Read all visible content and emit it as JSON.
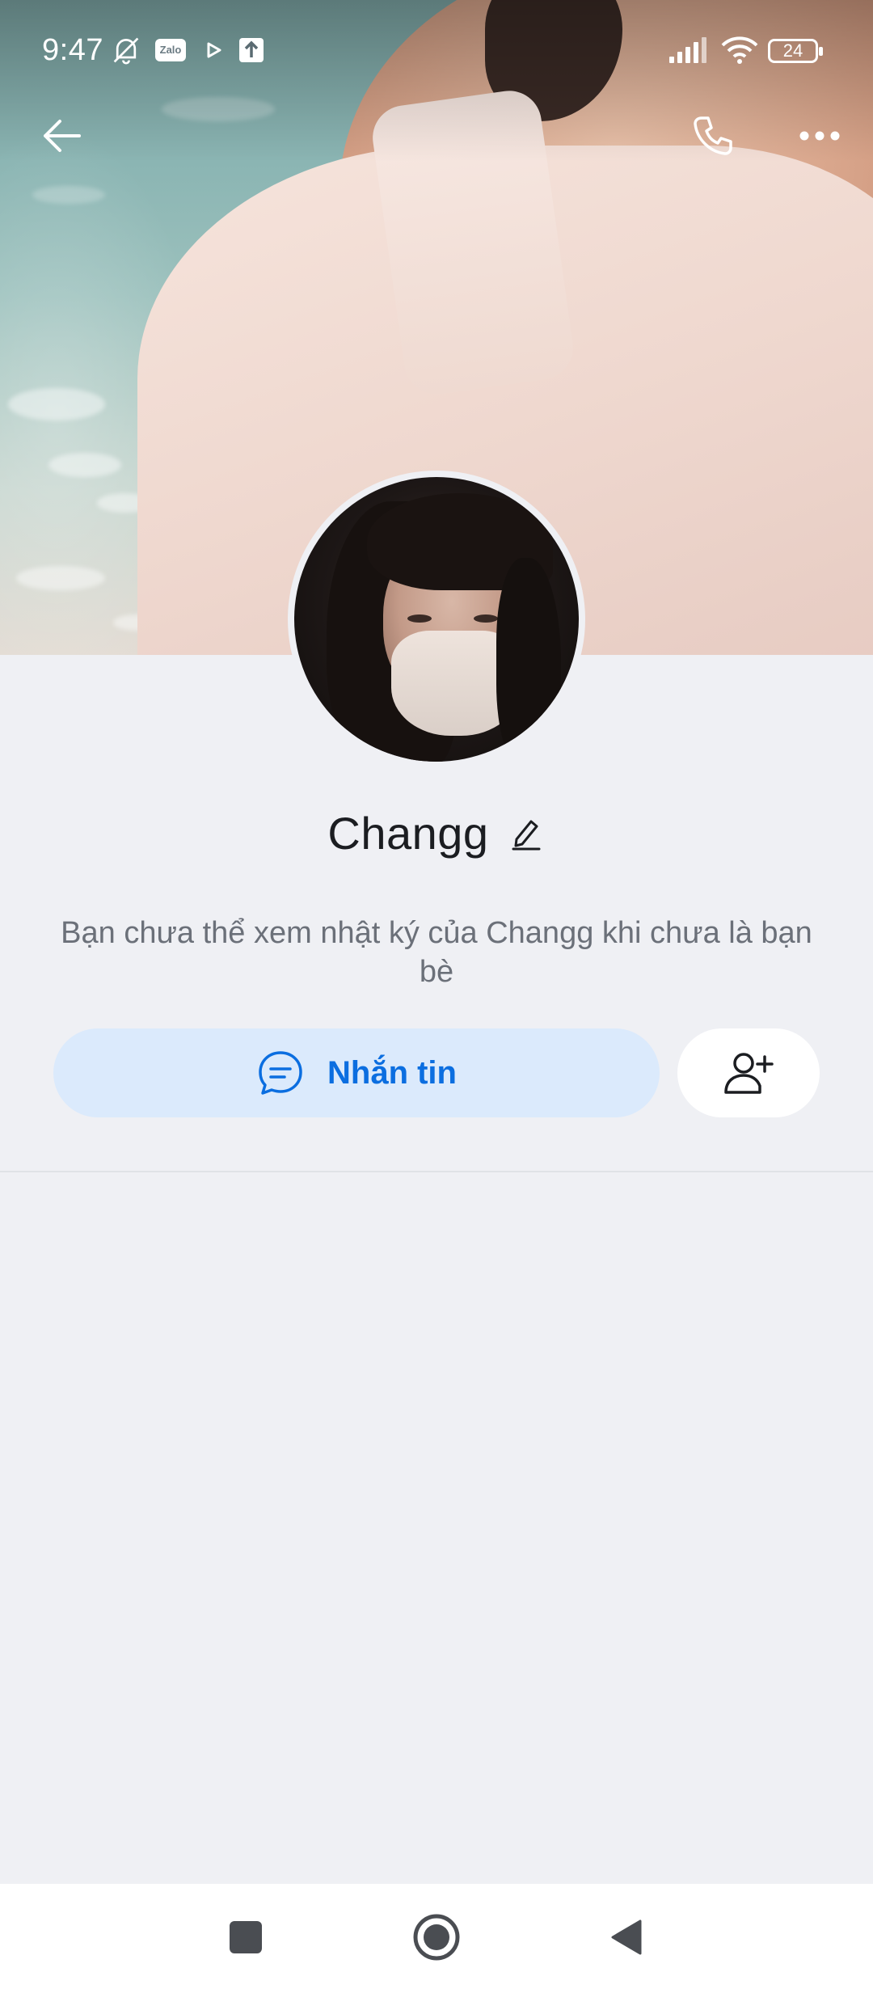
{
  "status_bar": {
    "time": "9:47",
    "badge": "Zalo",
    "battery": "24",
    "icons": [
      "mute-alarm-icon",
      "zalo-icon",
      "play-icon",
      "upload-icon",
      "signal-icon",
      "wifi-icon",
      "battery-icon"
    ]
  },
  "header": {
    "back_icon": "arrow-left-icon",
    "call_icon": "phone-icon",
    "more_icon": "more-horizontal-icon"
  },
  "profile": {
    "name": "Changg",
    "edit_icon": "pencil-icon",
    "notice": "Bạn chưa thể xem nhật ký của Changg khi chưa là bạn bè"
  },
  "actions": {
    "message_label": "Nhắn tin",
    "message_icon": "chat-bubble-icon",
    "add_friend_icon": "add-user-icon"
  },
  "colors": {
    "background": "#eff0f4",
    "accent": "#0b6ee0",
    "message_button_bg": "#dbeafc"
  },
  "system_nav": {
    "icons": [
      "recent-apps-icon",
      "home-icon",
      "back-triangle-icon"
    ]
  }
}
